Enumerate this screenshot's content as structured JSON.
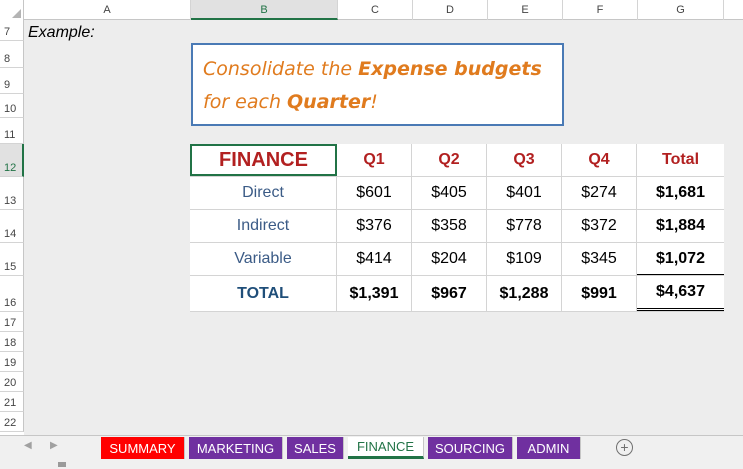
{
  "columns": [
    "A",
    "B",
    "C",
    "D",
    "E",
    "F",
    "G"
  ],
  "rows": [
    "7",
    "8",
    "9",
    "10",
    "11",
    "12",
    "13",
    "14",
    "15",
    "16",
    "17",
    "18",
    "19",
    "20",
    "21",
    "22"
  ],
  "example_label": "Example:",
  "callout": {
    "part1": "Consolidate the ",
    "bold1": "Expense budgets",
    "part2": " for each ",
    "bold2": "Quarter",
    "part3": "!"
  },
  "table": {
    "header": [
      "FINANCE",
      "Q1",
      "Q2",
      "Q3",
      "Q4",
      "Total"
    ],
    "rows": [
      [
        "Direct",
        "$601",
        "$405",
        "$401",
        "$274",
        "$1,681"
      ],
      [
        "Indirect",
        "$376",
        "$358",
        "$778",
        "$372",
        "$1,884"
      ],
      [
        "Variable",
        "$414",
        "$204",
        "$109",
        "$345",
        "$1,072"
      ]
    ],
    "total": [
      "TOTAL",
      "$1,391",
      "$967",
      "$1,288",
      "$991",
      "$4,637"
    ]
  },
  "tabs": [
    {
      "label": "SUMMARY",
      "color": "#ff0000"
    },
    {
      "label": "MARKETING",
      "color": "#7030a0"
    },
    {
      "label": "SALES",
      "color": "#7030a0"
    },
    {
      "label": "FINANCE",
      "color": "#ffffff",
      "active": true
    },
    {
      "label": "SOURCING",
      "color": "#7030a0"
    },
    {
      "label": "ADMIN",
      "color": "#7030a0"
    }
  ],
  "add_sheet_label": "+",
  "nav": {
    "prev": "◀",
    "next": "▶"
  }
}
